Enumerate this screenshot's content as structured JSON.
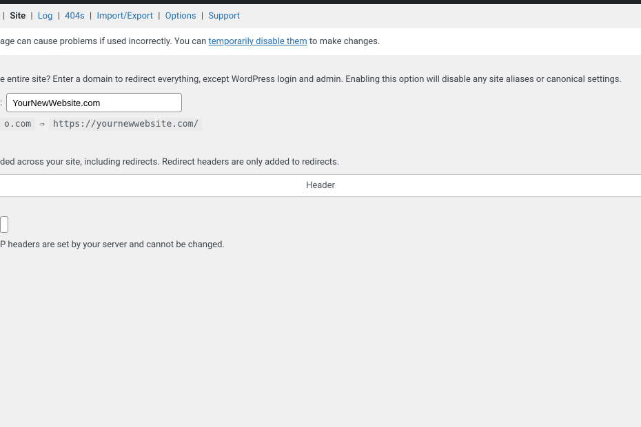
{
  "tabs": {
    "site": "Site",
    "log": "Log",
    "404s": "404s",
    "import_export": "Import/Export",
    "options": "Options",
    "support": "Support"
  },
  "warning": {
    "prefix": "age can cause problems if used incorrectly. You can ",
    "link": "temporarily disable them",
    "suffix": " to make changes."
  },
  "relocate": {
    "desc": "e entire site? Enter a domain to redirect everything, except WordPress login and admin. Enabling this option will disable any site aliases or canonical settings.",
    "label": ":",
    "value": "YourNewWebsite.com",
    "code_from": "o.com",
    "code_arrow": "⇒",
    "code_to": "https://yournewwebsite.com/"
  },
  "headers": {
    "desc": "ded across your site, including redirects. Redirect headers are only added to redirects.",
    "table_header": "Header",
    "note": "P headers are set by your server and cannot be changed."
  }
}
